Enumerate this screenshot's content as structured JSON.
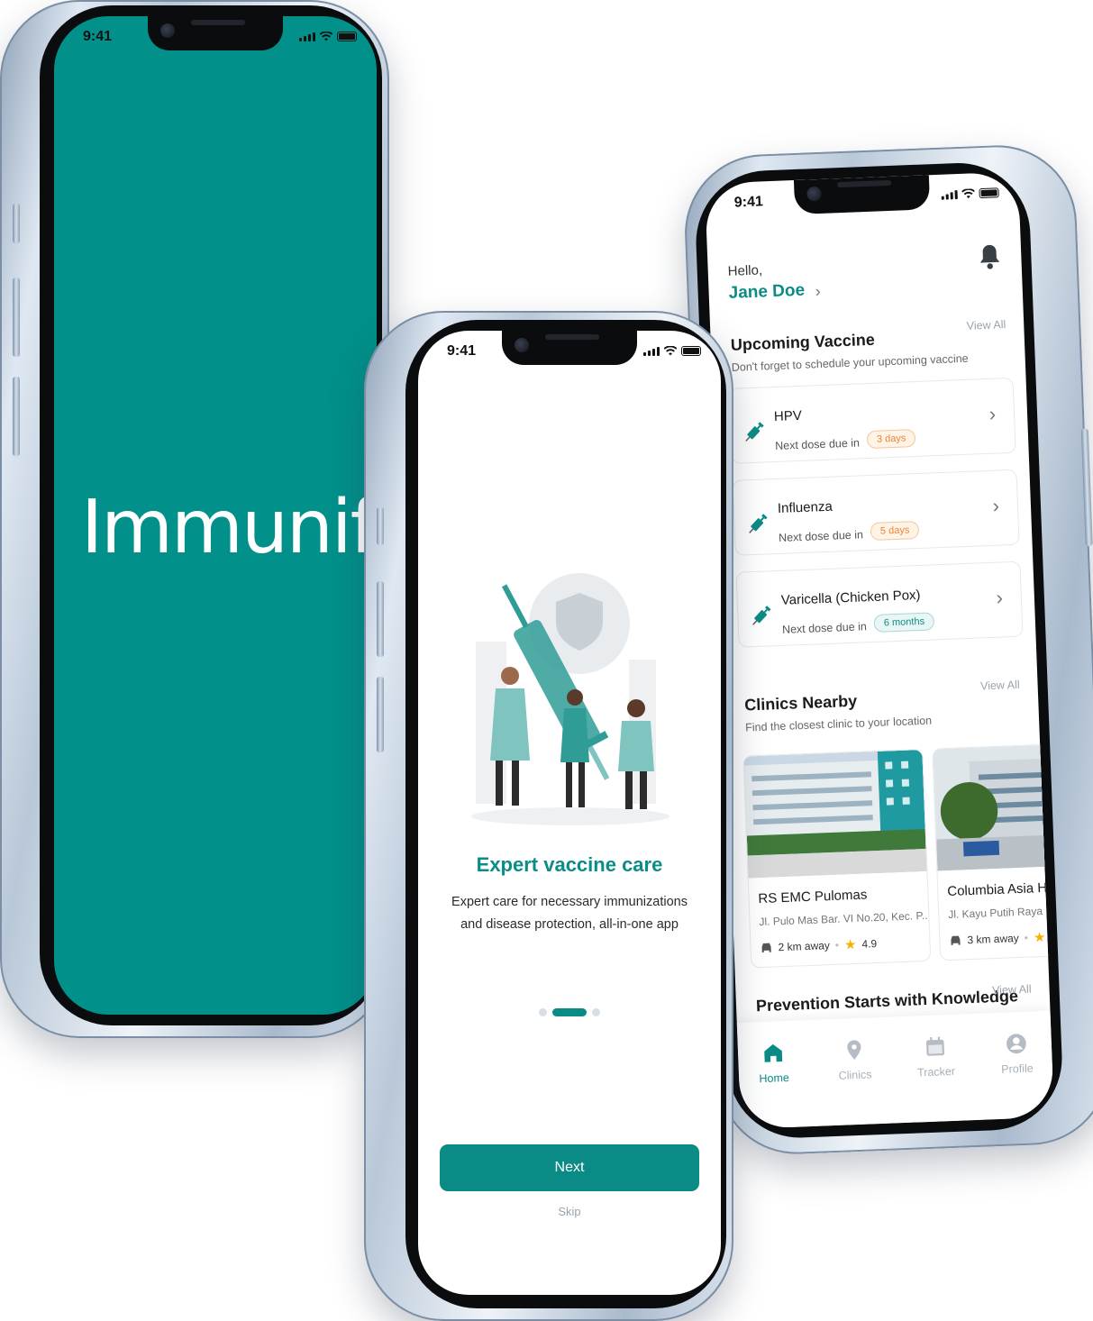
{
  "status": {
    "time": "9:41"
  },
  "splash": {
    "brand": "Immunify",
    "background_color": "#01908a"
  },
  "onboarding": {
    "title": "Expert vaccine care",
    "description": "Expert care for necessary immunizations and disease protection, all-in-one app",
    "page_indicator": {
      "active": 1,
      "total": 3
    },
    "next_label": "Next",
    "skip_label": "Skip"
  },
  "home": {
    "greeting": "Hello,",
    "user_name": "Jane Doe",
    "upcoming": {
      "title": "Upcoming Vaccine",
      "subtitle": "Don't forget to schedule your upcoming vaccine",
      "view_all": "View All",
      "items": [
        {
          "name": "HPV",
          "due_label": "Next dose due in",
          "badge": "3 days",
          "badge_color": "orange"
        },
        {
          "name": "Influenza",
          "due_label": "Next dose due in",
          "badge": "5 days",
          "badge_color": "orange"
        },
        {
          "name": "Varicella (Chicken Pox)",
          "due_label": "Next dose due in",
          "badge": "6 months",
          "badge_color": "teal"
        }
      ]
    },
    "clinics": {
      "title": "Clinics Nearby",
      "subtitle": "Find the closest clinic to your location",
      "view_all": "View All",
      "items": [
        {
          "name": "RS EMC Pulomas",
          "address": "Jl. Pulo Mas Bar. VI No.20, Kec. P...",
          "distance": "2 km away",
          "rating": "4.9"
        },
        {
          "name": "Columbia Asia Hospital",
          "address": "Jl. Kayu Putih Raya No",
          "distance": "3 km away",
          "rating": ""
        }
      ]
    },
    "knowledge": {
      "title": "Prevention Starts with Knowledge",
      "view_all": "View All"
    },
    "tabs": [
      {
        "label": "Home",
        "icon": "home-icon",
        "active": true
      },
      {
        "label": "Clinics",
        "icon": "location-pin-icon",
        "active": false
      },
      {
        "label": "Tracker",
        "icon": "calendar-icon",
        "active": false
      },
      {
        "label": "Profile",
        "icon": "user-icon",
        "active": false
      }
    ]
  },
  "colors": {
    "primary": "#0b8b85",
    "accent_orange": "#e6863a",
    "star": "#f5b301"
  }
}
